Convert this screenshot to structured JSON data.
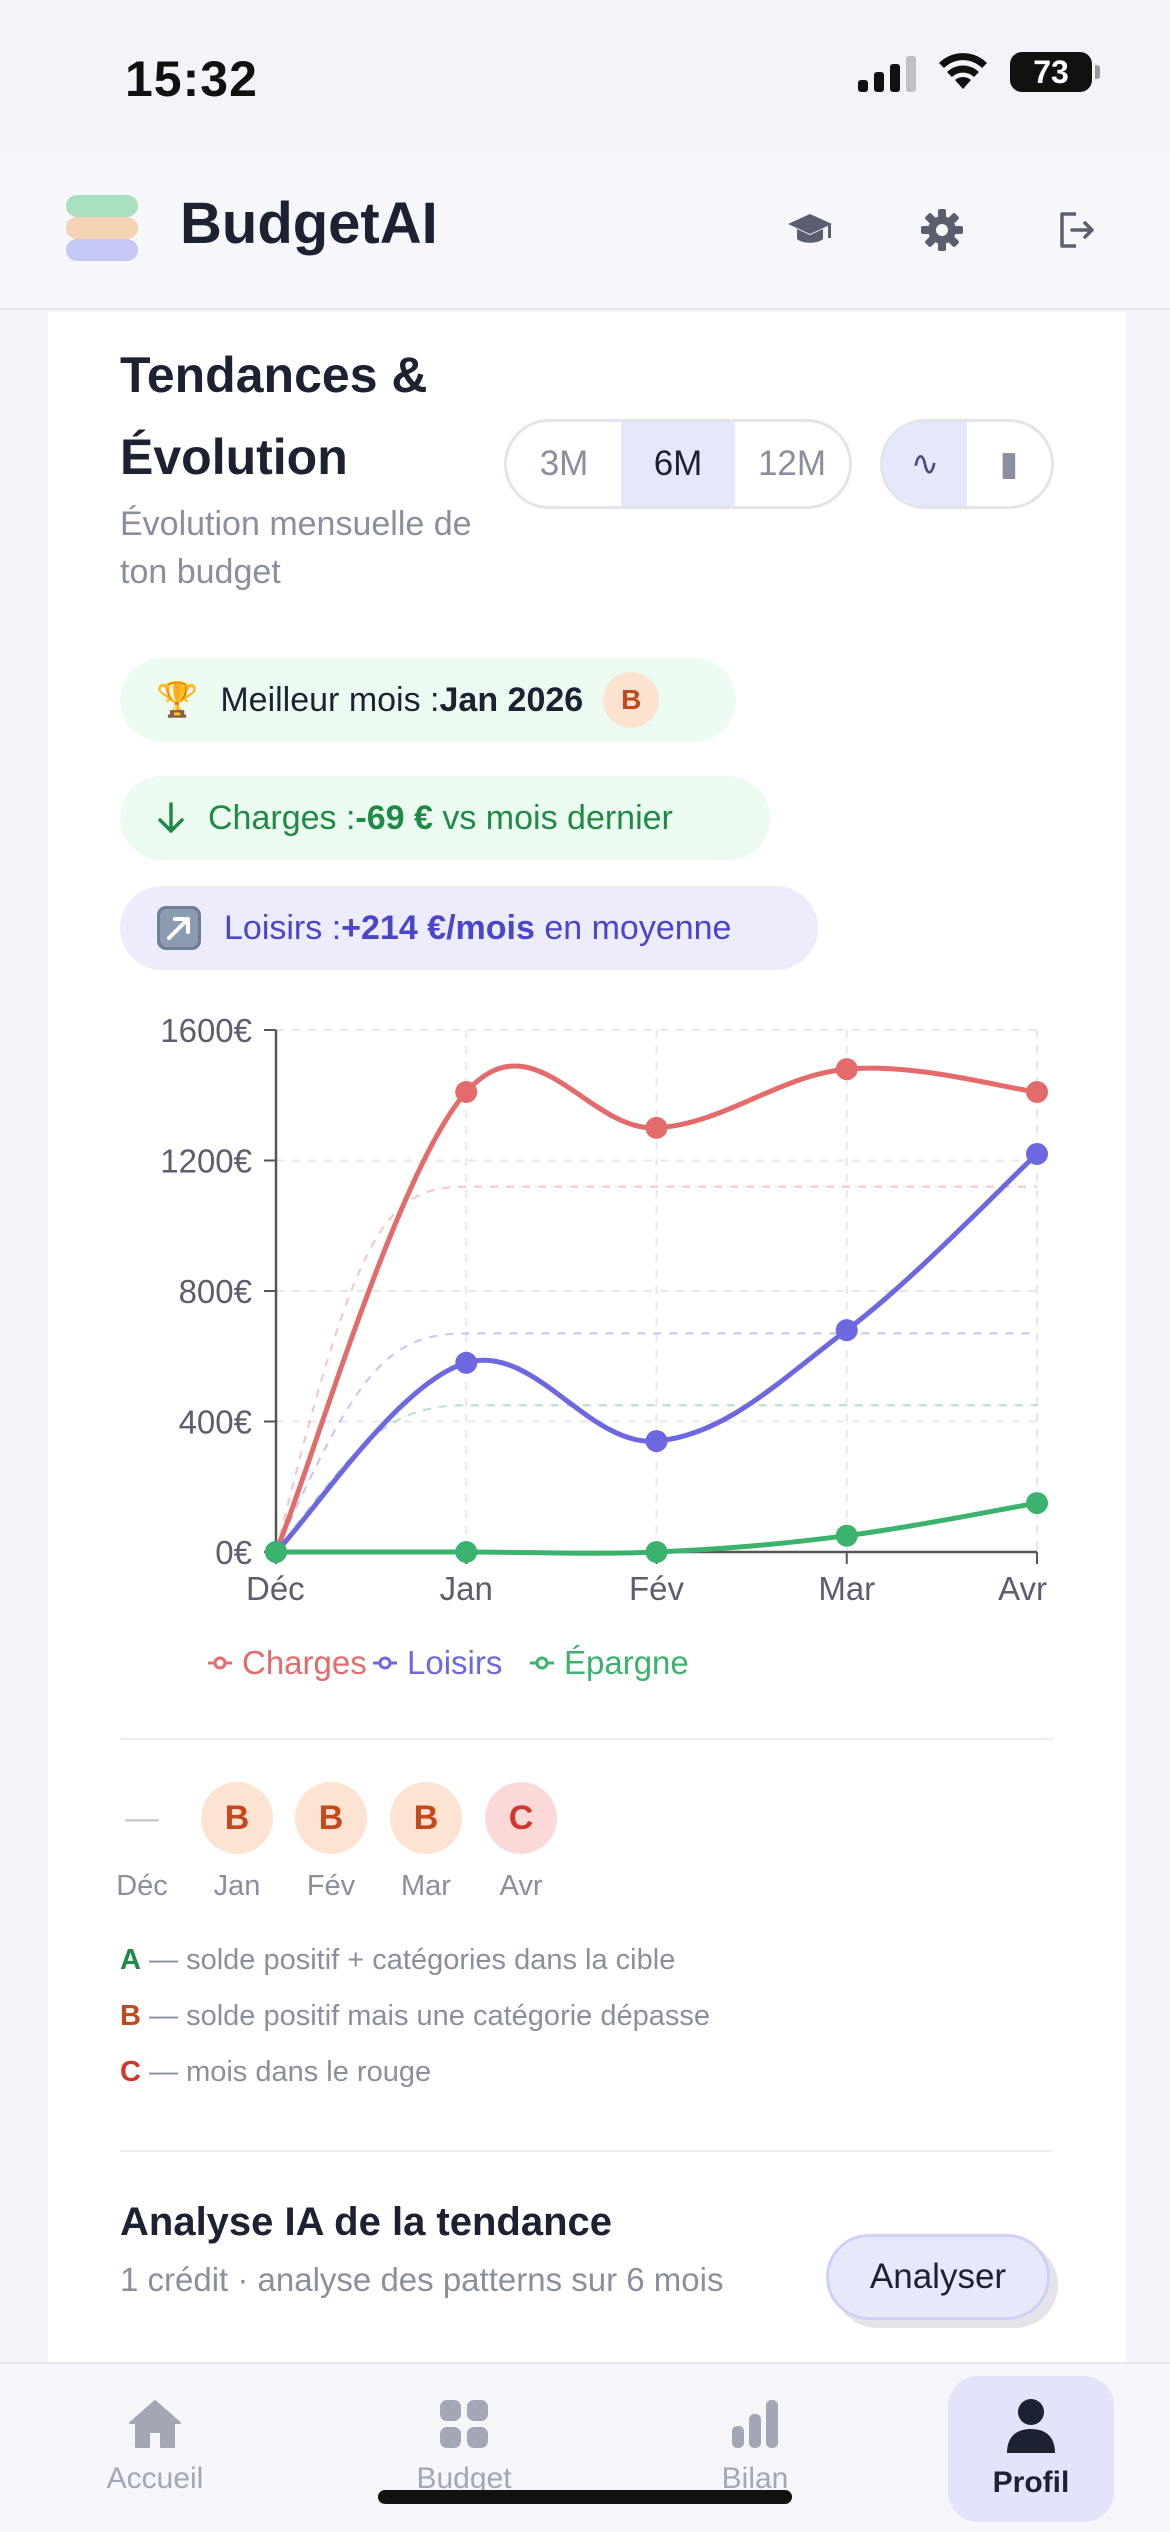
{
  "status_bar": {
    "time": "15:32",
    "battery": "73"
  },
  "header": {
    "app_title": "BudgetAI"
  },
  "trends": {
    "title_line1": "Tendances &",
    "title_line2": "Évolution",
    "subtitle": "Évolution mensuelle de ton budget",
    "periods": [
      "3M",
      "6M",
      "12M"
    ],
    "active_period": "6M",
    "chart_types": [
      "∿",
      "▮"
    ],
    "active_chart_type": "∿"
  },
  "insights": {
    "best_month_label": "Meilleur mois : ",
    "best_month_value": "Jan 2026",
    "best_month_grade": "B",
    "charges_label": "Charges : ",
    "charges_value": "-69 €",
    "charges_suffix": " vs mois dernier",
    "loisirs_label": "Loisirs : ",
    "loisirs_value": "+214 €/mois",
    "loisirs_suffix": " en moyenne"
  },
  "colors": {
    "charges": "#e36b6b",
    "loisirs": "#6d68e0",
    "epargne": "#3bb36f"
  },
  "chart_data": {
    "type": "line",
    "categories": [
      "Déc",
      "Jan",
      "Fév",
      "Mar",
      "Avr"
    ],
    "ylim": [
      0,
      1600
    ],
    "yticks": [
      "0€",
      "400€",
      "800€",
      "1200€",
      "1600€"
    ],
    "series": [
      {
        "name": "Charges",
        "values": [
          0,
          1410,
          1300,
          1480,
          1410
        ],
        "average": 1120
      },
      {
        "name": "Loisirs",
        "values": [
          0,
          580,
          340,
          680,
          1220
        ],
        "average": 670
      },
      {
        "name": "Épargne",
        "values": [
          0,
          0,
          0,
          50,
          150
        ],
        "average": 450
      }
    ],
    "grid": true,
    "legend_position": "bottom"
  },
  "grades": [
    {
      "month": "Déc",
      "grade": "—"
    },
    {
      "month": "Jan",
      "grade": "B"
    },
    {
      "month": "Fév",
      "grade": "B"
    },
    {
      "month": "Mar",
      "grade": "B"
    },
    {
      "month": "Avr",
      "grade": "C"
    }
  ],
  "grade_legend": [
    {
      "letter": "A",
      "text": " — solde positif + catégories dans la cible"
    },
    {
      "letter": "B",
      "text": " — solde positif mais une catégorie dépasse"
    },
    {
      "letter": "C",
      "text": " — mois dans le rouge"
    }
  ],
  "ai_analysis": {
    "title": "Analyse IA de la tendance",
    "subtitle": "1 crédit · analyse des patterns sur 6 mois",
    "button": "Analyser"
  },
  "tabs": [
    {
      "label": "Accueil",
      "icon": "home-icon"
    },
    {
      "label": "Budget",
      "icon": "grid-icon"
    },
    {
      "label": "Bilan",
      "icon": "bar-chart-icon"
    },
    {
      "label": "Profil",
      "icon": "user-icon"
    }
  ],
  "active_tab": "Profil"
}
